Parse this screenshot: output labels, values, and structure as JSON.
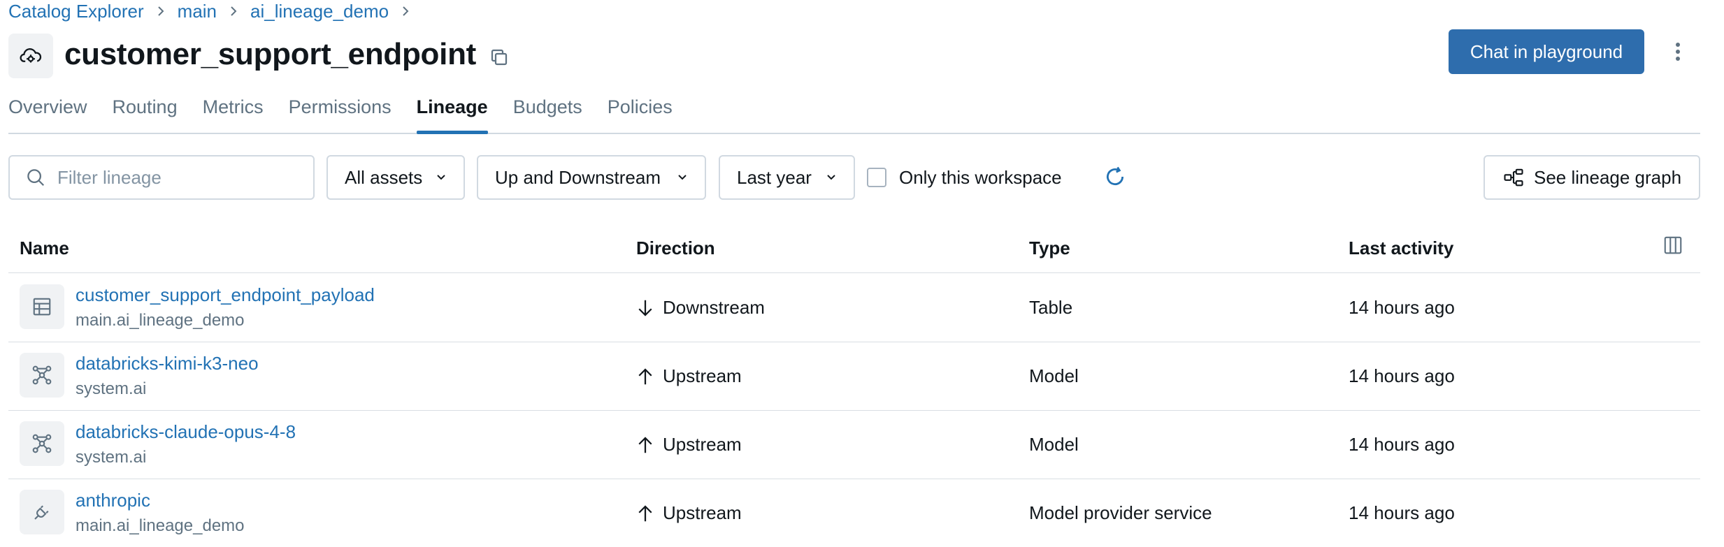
{
  "breadcrumb": {
    "items": [
      "Catalog Explorer",
      "main",
      "ai_lineage_demo"
    ]
  },
  "header": {
    "title": "customer_support_endpoint",
    "primary_button": "Chat in playground"
  },
  "tabs": [
    "Overview",
    "Routing",
    "Metrics",
    "Permissions",
    "Lineage",
    "Budgets",
    "Policies"
  ],
  "active_tab": "Lineage",
  "filters": {
    "search_placeholder": "Filter lineage",
    "assets": "All assets",
    "direction": "Up and Downstream",
    "time_range": "Last year",
    "only_workspace_label": "Only this workspace",
    "only_workspace_checked": false,
    "graph_button": "See lineage graph"
  },
  "table": {
    "headers": {
      "name": "Name",
      "direction": "Direction",
      "type": "Type",
      "last_activity": "Last activity"
    },
    "rows": [
      {
        "name": "customer_support_endpoint_payload",
        "schema": "main.ai_lineage_demo",
        "direction": "Downstream",
        "type": "Table",
        "last_activity": "14 hours ago",
        "icon": "table-icon"
      },
      {
        "name": "databricks-kimi-k3-neo",
        "schema": "system.ai",
        "direction": "Upstream",
        "type": "Model",
        "last_activity": "14 hours ago",
        "icon": "model-icon"
      },
      {
        "name": "databricks-claude-opus-4-8",
        "schema": "system.ai",
        "direction": "Upstream",
        "type": "Model",
        "last_activity": "14 hours ago",
        "icon": "model-icon"
      },
      {
        "name": "anthropic",
        "schema": "main.ai_lineage_demo",
        "direction": "Upstream",
        "type": "Model provider service",
        "last_activity": "14 hours ago",
        "icon": "plug-icon"
      }
    ]
  },
  "colors": {
    "link": "#2272b4",
    "primary": "#2e6dad",
    "muted": "#5f7281"
  }
}
